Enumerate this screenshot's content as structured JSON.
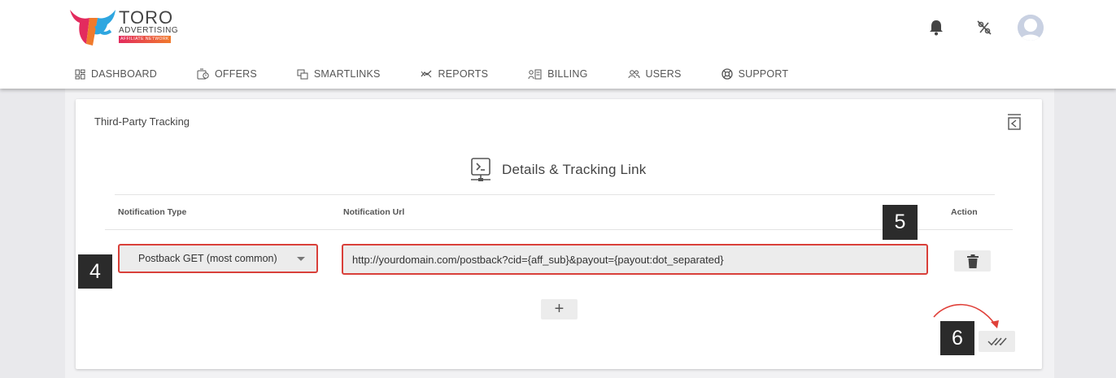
{
  "brand": {
    "name": "TORO",
    "sub": "ADVERTISING",
    "strip": "AFFILIATE NETWORK"
  },
  "header": {
    "icons": [
      "bell-icon",
      "percent-off-icon",
      "user-avatar-icon"
    ]
  },
  "nav": [
    {
      "label": "DASHBOARD",
      "icon": "dashboard-icon"
    },
    {
      "label": "OFFERS",
      "icon": "offers-icon"
    },
    {
      "label": "SMARTLINKS",
      "icon": "smartlinks-icon"
    },
    {
      "label": "REPORTS",
      "icon": "reports-icon"
    },
    {
      "label": "BILLING",
      "icon": "billing-icon"
    },
    {
      "label": "USERS",
      "icon": "users-icon"
    },
    {
      "label": "SUPPORT",
      "icon": "support-icon"
    }
  ],
  "card": {
    "title": "Third-Party Tracking",
    "section_title": "Details & Tracking Link",
    "columns": {
      "notification_type": "Notification Type",
      "notification_url": "Notification Url",
      "action": "Action"
    },
    "row": {
      "type_value": "Postback GET (most common)",
      "url_value": "http://yourdomain.com/postback?cid={aff_sub}&payout={payout:dot_separated}"
    },
    "add_label": "+"
  },
  "annotations": {
    "step4": "4",
    "step5": "5",
    "step6": "6"
  },
  "colors": {
    "highlight": "#d9403a",
    "badge": "#2b2b2b"
  }
}
